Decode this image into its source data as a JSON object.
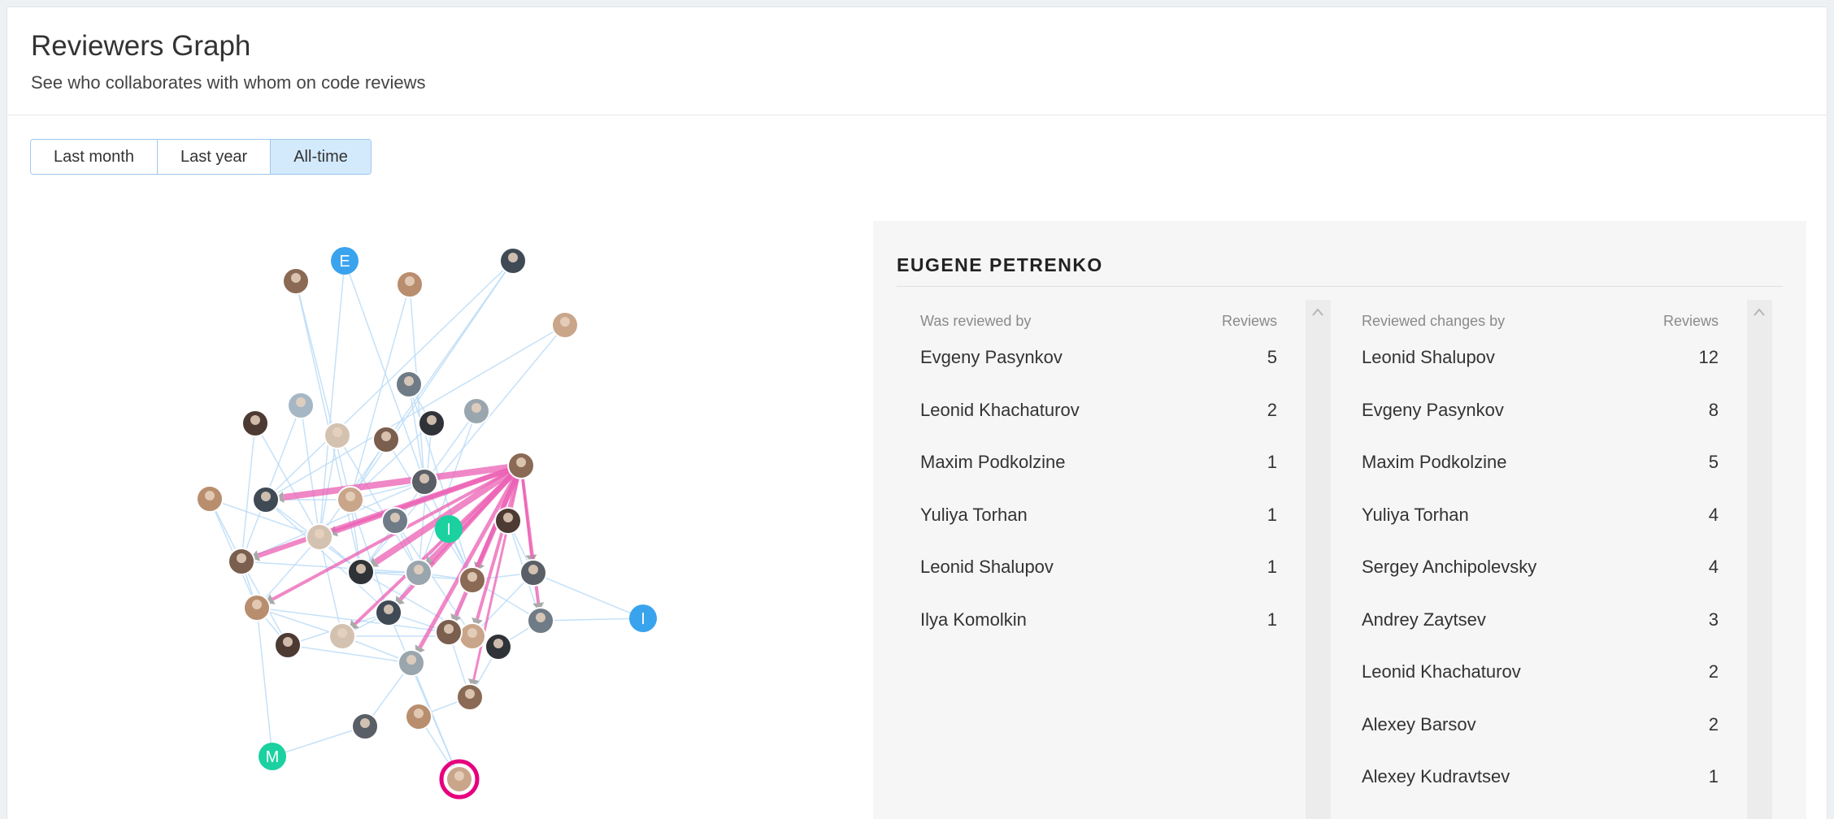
{
  "header": {
    "title": "Reviewers Graph",
    "subtitle": "See who collaborates with whom on code reviews"
  },
  "period_tabs": [
    {
      "label": "Last month",
      "active": false
    },
    {
      "label": "Last year",
      "active": false
    },
    {
      "label": "All-time",
      "active": true
    }
  ],
  "graph": {
    "letter_avatars": [
      "E",
      "I",
      "I",
      "M"
    ],
    "colors": {
      "edge": "#bcdcf7",
      "highlight_edge": "#ec5fb4",
      "selected_ring": "#e6007e",
      "avatar_teal": "#1bd1a0",
      "avatar_blue": "#3aa3ee"
    }
  },
  "panel": {
    "selected_user": "EUGENE PETRENKO",
    "was_reviewed_by": {
      "header_name": "Was reviewed by",
      "header_value": "Reviews",
      "rows": [
        {
          "name": "Evgeny Pasynkov",
          "value": "5"
        },
        {
          "name": "Leonid Khachaturov",
          "value": "2"
        },
        {
          "name": "Maxim Podkolzine",
          "value": "1"
        },
        {
          "name": "Yuliya Torhan",
          "value": "1"
        },
        {
          "name": "Leonid Shalupov",
          "value": "1"
        },
        {
          "name": "Ilya Komolkin",
          "value": "1"
        }
      ]
    },
    "reviewed_changes_by": {
      "header_name": "Reviewed changes by",
      "header_value": "Reviews",
      "rows": [
        {
          "name": "Leonid Shalupov",
          "value": "12"
        },
        {
          "name": "Evgeny Pasynkov",
          "value": "8"
        },
        {
          "name": "Maxim Podkolzine",
          "value": "5"
        },
        {
          "name": "Yuliya Torhan",
          "value": "4"
        },
        {
          "name": "Sergey Anchipolevsky",
          "value": "4"
        },
        {
          "name": "Andrey Zaytsev",
          "value": "3"
        },
        {
          "name": "Leonid Khachaturov",
          "value": "2"
        },
        {
          "name": "Alexey Barsov",
          "value": "2"
        },
        {
          "name": "Alexey Kudravtsev",
          "value": "1"
        }
      ]
    }
  }
}
